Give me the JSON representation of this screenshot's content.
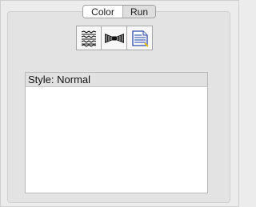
{
  "tabs": [
    {
      "label": "Color",
      "selected": true
    },
    {
      "label": "Run",
      "selected": false
    }
  ],
  "toolbar": {
    "buttons": [
      {
        "icon": "zigzag-lines-icon"
      },
      {
        "icon": "bowtie-icon"
      },
      {
        "icon": "document-icon"
      }
    ]
  },
  "style_panel": {
    "header": "Style: Normal"
  },
  "colors": {
    "background": "#ececec",
    "group_box": "#e3e3e3",
    "accent_blue": "#2f4aa8"
  }
}
